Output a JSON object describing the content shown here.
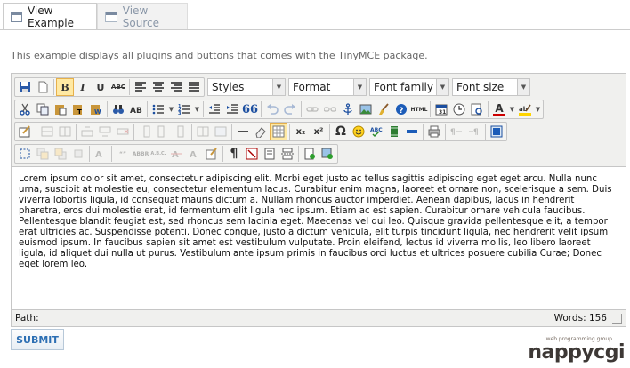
{
  "tabs": [
    {
      "label": "View Example",
      "icon": "document-icon"
    },
    {
      "label": "View Source",
      "icon": "source-icon"
    }
  ],
  "description": "This example displays all plugins and buttons that comes with the TinyMCE package.",
  "toolbar": {
    "selects": {
      "styles": "Styles",
      "format": "Format",
      "font_family": "Font family",
      "font_size": "Font size"
    },
    "text_buttons": {
      "bold": "B",
      "italic": "I",
      "underline": "U",
      "strike": "ABC",
      "html": "HTML",
      "omega": "Ω",
      "sub": "x₂",
      "sup": "x²",
      "pilcrow": "¶",
      "abbr": "ABBR",
      "acronym": "A.B.C.",
      "font_color": "A",
      "quote": "66"
    }
  },
  "editor": {
    "content": "Lorem ipsum dolor sit amet, consectetur adipiscing elit. Morbi eget justo ac tellus sagittis adipiscing eget eget arcu. Nulla nunc urna, suscipit at molestie eu, consectetur elementum lacus. Curabitur enim magna, laoreet et ornare non, scelerisque a sem. Duis viverra lobortis ligula, id consequat mauris dictum a. Nullam rhoncus auctor imperdiet. Aenean dapibus, lacus in hendrerit pharetra, eros dui molestie erat, id fermentum elit ligula nec ipsum. Etiam ac est sapien. Curabitur ornare vehicula faucibus. Pellentesque blandit feugiat est, sed rhoncus sem lacinia eget. Maecenas vel dui leo. Quisque gravida pellentesque elit, a tempor erat ultricies ac. Suspendisse potenti. Donec congue, justo a dictum vehicula, elit turpis tincidunt ligula, nec hendrerit velit ipsum euismod ipsum. In faucibus sapien sit amet est vestibulum vulputate. Proin eleifend, lectus id viverra mollis, leo libero laoreet ligula, id aliquet dui nulla ut purus. Vestibulum ante ipsum primis in faucibus orci luctus et ultrices posuere cubilia Curae; Donec eget lorem leo.",
    "path_label": "Path:",
    "word_count": "Words: 156"
  },
  "submit_label": "SUBMIT",
  "logo": {
    "tagline": "web programming group",
    "wordmark": "nappycgi"
  },
  "colors": {
    "active_button": "#ffe9a3",
    "submit_text": "#2d6fb3",
    "font_color_bar": "#cc0000",
    "highlight_bar": "#ffd400"
  }
}
